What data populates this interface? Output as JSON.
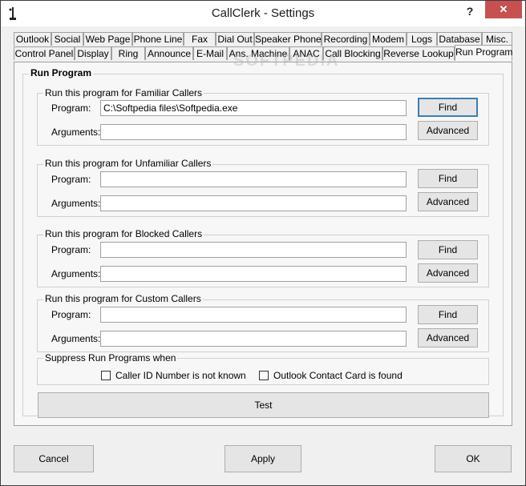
{
  "window": {
    "title": "CallClerk - Settings",
    "help": "?",
    "close": "✕"
  },
  "tabs_row1": [
    "Outlook",
    "Social",
    "Web Page",
    "Phone Line",
    "Fax",
    "Dial Out",
    "Speaker Phone",
    "Recording",
    "Modem",
    "Logs",
    "Database",
    "Misc."
  ],
  "tabs_row2": [
    "Control Panel",
    "Display",
    "Ring",
    "Announce",
    "E-Mail",
    "Ans. Machine",
    "ANAC",
    "Call Blocking",
    "Reverse Lookup",
    "Run Program"
  ],
  "active_tab": "Run Program",
  "watermark": "SOFTPEDIA",
  "panel": {
    "title": "Run Program",
    "program_label": "Program:",
    "arguments_label": "Arguments:",
    "find_label": "Find",
    "advanced_label": "Advanced",
    "groups": [
      {
        "title": "Run this program for Familiar Callers",
        "program": "C:\\Softpedia files\\Softpedia.exe",
        "arguments": ""
      },
      {
        "title": "Run this program for Unfamiliar Callers",
        "program": "",
        "arguments": ""
      },
      {
        "title": "Run this program for Blocked Callers",
        "program": "",
        "arguments": ""
      },
      {
        "title": "Run this program for Custom Callers",
        "program": "",
        "arguments": ""
      }
    ],
    "suppress": {
      "title": "Suppress Run Programs when",
      "option1": "Caller ID Number is not known",
      "option2": "Outlook Contact Card is found"
    },
    "test_label": "Test"
  },
  "footer": {
    "cancel": "Cancel",
    "apply": "Apply",
    "ok": "OK"
  }
}
